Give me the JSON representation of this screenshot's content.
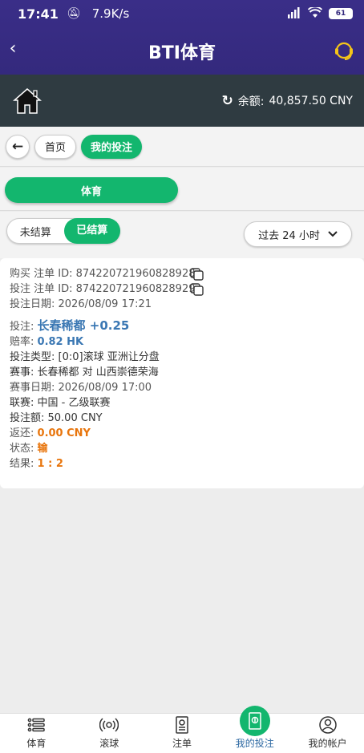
{
  "status_bar": {
    "time": "17:41",
    "speed": "7.9K/s",
    "battery": "61",
    "signal": "HD"
  },
  "header": {
    "title": "BTI体育"
  },
  "account": {
    "balance_label": "余额:",
    "balance_value": "40,857.50 CNY"
  },
  "nav": {
    "home_label": "首页",
    "my_bets_label": "我的投注"
  },
  "sport_button": "体育",
  "filters": {
    "unsettled": "未结算",
    "settled": "已结算",
    "time_range": "过去 24 小时"
  },
  "bet": {
    "buy_id": "购买 注单 ID: 874220721960828928",
    "bet_id": "投注 注单 ID: 874220721960828929",
    "bet_date": "投注日期: 2026/08/09 17:21",
    "pick_label": "投注:",
    "pick_value": "长春稀都 +0.25",
    "odds_label": "赔率:",
    "odds_value": "0.82 HK",
    "type": "投注类型: [0:0]滚球 亚洲让分盘",
    "match": "赛事: 长春稀都 对 山西崇德荣海",
    "match_date": "赛事日期: 2026/08/09 17:00",
    "league": "联赛: 中国 - 乙级联赛",
    "stake": "投注额: 50.00 CNY",
    "return_label": "返还:",
    "return_value": "0.00 CNY",
    "status_label": "状态:",
    "status_value": "输",
    "result_label": "结果:",
    "result_value": "1 : 2"
  },
  "tabs": [
    {
      "label": "体育",
      "icon": "list-icon"
    },
    {
      "label": "滚球",
      "icon": "live-icon"
    },
    {
      "label": "注单",
      "icon": "betslip-icon"
    },
    {
      "label": "我的投注",
      "icon": "my-bets-icon"
    },
    {
      "label": "我的帐户",
      "icon": "account-icon"
    }
  ],
  "colors": {
    "header": "#34297d",
    "account_bar": "#2f3b41",
    "accent_green": "#13b66e",
    "blue_text": "#3a77b3",
    "orange_text": "#e8750c"
  }
}
